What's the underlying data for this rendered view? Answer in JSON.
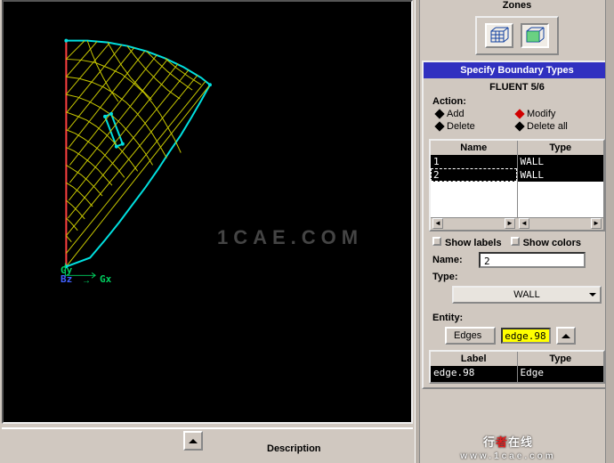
{
  "viewport": {
    "axis_gy": "Gy",
    "axis_bz": "Bz",
    "axis_gx": "Gx",
    "watermark": "1CAE.COM"
  },
  "zones": {
    "title": "Zones"
  },
  "boundary": {
    "title": "Specify Boundary Types",
    "solver": "FLUENT 5/6",
    "action_label": "Action:",
    "actions": {
      "add": "Add",
      "modify": "Modify",
      "delete": "Delete",
      "delete_all": "Delete all"
    },
    "col_name": "Name",
    "col_type": "Type",
    "rows": [
      {
        "name": "1",
        "type": "WALL"
      },
      {
        "name": "2",
        "type": "WALL"
      }
    ],
    "show_labels": "Show labels",
    "show_colors": "Show colors",
    "name_label": "Name:",
    "name_value": "2",
    "type_label": "Type:",
    "type_value": "WALL",
    "entity_label": "Entity:",
    "entity_kind": "Edges",
    "entity_pick": "edge.98",
    "lt_label_hdr": "Label",
    "lt_type_hdr": "Type",
    "lt_label_val": "edge.98",
    "lt_type_val": "Edge"
  },
  "bottom": {
    "description": "Description"
  },
  "footer": {
    "brand_prefix": "行",
    "brand_red": "者",
    "brand_suffix": "在线",
    "domain": "www.1cae.com"
  }
}
